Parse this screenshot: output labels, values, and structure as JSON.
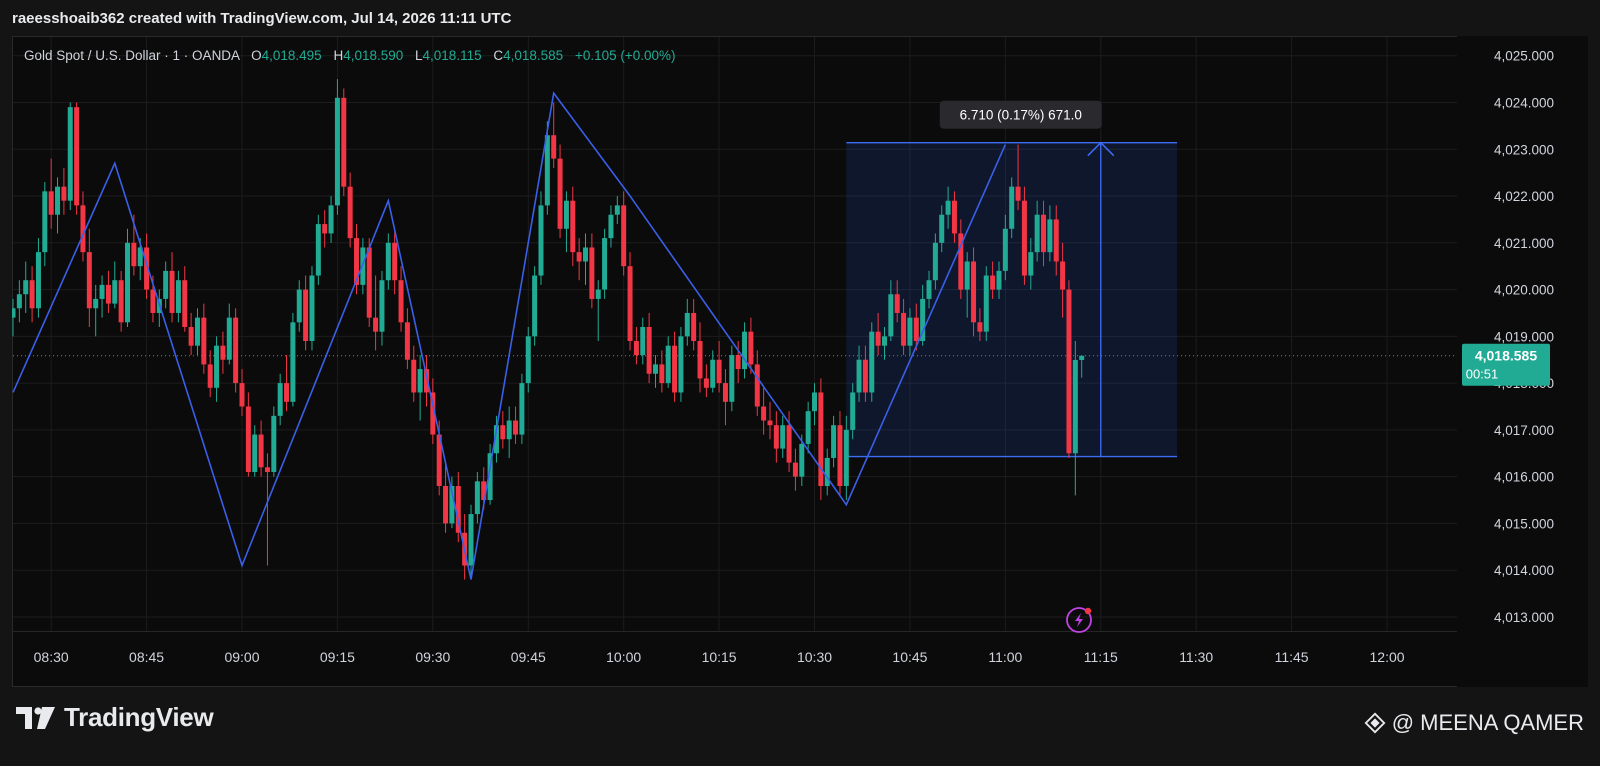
{
  "header": {
    "attribution": "raeesshoaib362 created with TradingView.com, Jul 14, 2026 11:11 UTC"
  },
  "legend": {
    "symbol": "Gold Spot / U.S. Dollar · 1 · OANDA",
    "open_label": "O",
    "open": "4,018.495",
    "high_label": "H",
    "high": "4,018.590",
    "low_label": "L",
    "low": "4,018.115",
    "close_label": "C",
    "close": "4,018.585",
    "change": "+0.105 (+0.00%)"
  },
  "price_tag": {
    "price": "4,018.585",
    "countdown": "00:51"
  },
  "measure": {
    "label": "6.710 (0.17%) 671.0",
    "from_time": "10:35",
    "to_time": "11:27",
    "low": 4016.43,
    "high": 4023.14,
    "arrow_time": "11:15"
  },
  "chart_data": {
    "type": "candlestick",
    "symbol": "Gold Spot / U.S. Dollar",
    "interval": "1",
    "exchange": "OANDA",
    "y_ticks": [
      "4,025.000",
      "4,024.000",
      "4,023.000",
      "4,022.000",
      "4,021.000",
      "4,020.000",
      "4,019.000",
      "4,018.000",
      "4,017.000",
      "4,016.000",
      "4,015.000",
      "4,014.000",
      "4,013.000"
    ],
    "x_ticks": [
      "08:30",
      "08:45",
      "09:00",
      "09:15",
      "09:30",
      "09:45",
      "10:00",
      "10:15",
      "10:30",
      "10:45",
      "11:00",
      "11:15",
      "11:30",
      "11:45",
      "12:00"
    ],
    "ylim": [
      4012.7,
      4025.4
    ],
    "xlim": [
      "08:24",
      "12:11"
    ],
    "last_price": 4018.585,
    "zigzag": [
      {
        "t": "08:24",
        "p": 4017.8
      },
      {
        "t": "08:40",
        "p": 4022.7
      },
      {
        "t": "09:00",
        "p": 4014.1
      },
      {
        "t": "09:23",
        "p": 4021.9
      },
      {
        "t": "09:36",
        "p": 4013.8
      },
      {
        "t": "09:49",
        "p": 4024.2
      },
      {
        "t": "10:01",
        "p": 4022.0
      },
      {
        "t": "10:35",
        "p": 4015.4
      },
      {
        "t": "11:00",
        "p": 4023.1
      }
    ],
    "candles": [
      [
        "08:24",
        4019.4,
        4019.8,
        4019.0,
        4019.6
      ],
      [
        "08:25",
        4019.6,
        4020.2,
        4019.3,
        4019.9
      ],
      [
        "08:26",
        4019.9,
        4020.6,
        4019.5,
        4020.2
      ],
      [
        "08:27",
        4020.2,
        4020.5,
        4019.3,
        4019.6
      ],
      [
        "08:28",
        4019.6,
        4021.1,
        4019.4,
        4020.8
      ],
      [
        "08:29",
        4020.8,
        4022.3,
        4020.5,
        4022.1
      ],
      [
        "08:30",
        4022.1,
        4022.8,
        4021.3,
        4021.6
      ],
      [
        "08:31",
        4021.6,
        4022.4,
        4021.2,
        4022.2
      ],
      [
        "08:32",
        4022.2,
        4022.6,
        4021.6,
        4021.9
      ],
      [
        "08:33",
        4021.9,
        4024.0,
        4021.7,
        4023.9
      ],
      [
        "08:34",
        4023.9,
        4024.0,
        4021.6,
        4021.8
      ],
      [
        "08:35",
        4021.8,
        4022.1,
        4020.6,
        4020.8
      ],
      [
        "08:36",
        4020.8,
        4021.3,
        4019.2,
        4019.6
      ],
      [
        "08:37",
        4019.6,
        4020.1,
        4019.0,
        4019.8
      ],
      [
        "08:38",
        4019.8,
        4020.3,
        4019.4,
        4020.1
      ],
      [
        "08:39",
        4020.1,
        4020.4,
        4019.5,
        4019.7
      ],
      [
        "08:40",
        4019.7,
        4020.6,
        4019.6,
        4020.2
      ],
      [
        "08:41",
        4020.2,
        4020.4,
        4019.1,
        4019.3
      ],
      [
        "08:42",
        4019.3,
        4021.3,
        4019.2,
        4021.0
      ],
      [
        "08:43",
        4021.0,
        4021.6,
        4020.3,
        4020.5
      ],
      [
        "08:44",
        4020.5,
        4021.1,
        4020.2,
        4020.9
      ],
      [
        "08:45",
        4020.9,
        4021.2,
        4019.8,
        4020.0
      ],
      [
        "08:46",
        4020.0,
        4020.3,
        4019.3,
        4019.5
      ],
      [
        "08:47",
        4019.5,
        4020.0,
        4019.2,
        4019.8
      ],
      [
        "08:48",
        4019.8,
        4020.6,
        4019.6,
        4020.4
      ],
      [
        "08:49",
        4020.4,
        4020.8,
        4019.3,
        4019.5
      ],
      [
        "08:50",
        4019.5,
        4020.4,
        4019.3,
        4020.2
      ],
      [
        "08:51",
        4020.2,
        4020.5,
        4019.1,
        4019.2
      ],
      [
        "08:52",
        4019.2,
        4019.5,
        4018.6,
        4018.8
      ],
      [
        "08:53",
        4018.8,
        4019.6,
        4018.6,
        4019.4
      ],
      [
        "08:54",
        4019.4,
        4019.7,
        4018.2,
        4018.4
      ],
      [
        "08:55",
        4018.4,
        4018.7,
        4017.7,
        4017.9
      ],
      [
        "08:56",
        4017.9,
        4019.0,
        4017.6,
        4018.8
      ],
      [
        "08:57",
        4018.8,
        4019.1,
        4018.2,
        4018.5
      ],
      [
        "08:58",
        4018.5,
        4019.7,
        4018.4,
        4019.4
      ],
      [
        "08:59",
        4019.4,
        4019.6,
        4017.8,
        4018.0
      ],
      [
        "09:00",
        4018.0,
        4018.3,
        4017.3,
        4017.5
      ],
      [
        "09:01",
        4017.5,
        4017.8,
        4016.0,
        4016.1
      ],
      [
        "09:02",
        4016.1,
        4017.1,
        4016.0,
        4016.9
      ],
      [
        "09:03",
        4016.9,
        4017.2,
        4016.0,
        4016.2
      ],
      [
        "09:04",
        4016.2,
        4016.5,
        4014.1,
        4016.1
      ],
      [
        "09:05",
        4016.1,
        4017.5,
        4016.0,
        4017.3
      ],
      [
        "09:06",
        4017.3,
        4018.2,
        4017.1,
        4018.0
      ],
      [
        "09:07",
        4018.0,
        4018.6,
        4017.4,
        4017.6
      ],
      [
        "09:08",
        4017.6,
        4019.5,
        4017.5,
        4019.3
      ],
      [
        "09:09",
        4019.3,
        4020.2,
        4019.1,
        4020.0
      ],
      [
        "09:10",
        4020.0,
        4020.3,
        4018.7,
        4018.9
      ],
      [
        "09:11",
        4018.9,
        4020.5,
        4018.7,
        4020.3
      ],
      [
        "09:12",
        4020.3,
        4021.6,
        4020.1,
        4021.4
      ],
      [
        "09:13",
        4021.4,
        4021.7,
        4020.9,
        4021.2
      ],
      [
        "09:14",
        4021.2,
        4022.0,
        4021.0,
        4021.8
      ],
      [
        "09:15",
        4021.8,
        4024.5,
        4021.6,
        4024.1
      ],
      [
        "09:16",
        4024.1,
        4024.3,
        4022.0,
        4022.2
      ],
      [
        "09:17",
        4022.2,
        4022.5,
        4020.9,
        4021.1
      ],
      [
        "09:18",
        4021.1,
        4021.4,
        4019.9,
        4020.1
      ],
      [
        "09:19",
        4020.1,
        4021.1,
        4019.9,
        4020.9
      ],
      [
        "09:20",
        4020.9,
        4021.1,
        4019.2,
        4019.4
      ],
      [
        "09:21",
        4019.4,
        4020.3,
        4018.7,
        4019.1
      ],
      [
        "09:22",
        4019.1,
        4020.4,
        4018.8,
        4020.2
      ],
      [
        "09:23",
        4020.2,
        4021.2,
        4020.0,
        4021.0
      ],
      [
        "09:24",
        4021.0,
        4021.3,
        4019.9,
        4020.2
      ],
      [
        "09:25",
        4020.2,
        4020.5,
        4019.1,
        4019.3
      ],
      [
        "09:26",
        4019.3,
        4019.6,
        4018.3,
        4018.5
      ],
      [
        "09:27",
        4018.5,
        4018.8,
        4017.6,
        4017.8
      ],
      [
        "09:28",
        4017.8,
        4018.6,
        4017.2,
        4018.3
      ],
      [
        "09:29",
        4018.3,
        4018.6,
        4017.5,
        4017.8
      ],
      [
        "09:30",
        4017.8,
        4018.1,
        4016.7,
        4016.9
      ],
      [
        "09:31",
        4016.9,
        4017.2,
        4015.6,
        4015.8
      ],
      [
        "09:32",
        4015.8,
        4016.3,
        4014.8,
        4015.0
      ],
      [
        "09:33",
        4015.0,
        4016.0,
        4014.9,
        4015.8
      ],
      [
        "09:34",
        4015.8,
        4016.1,
        4014.6,
        4014.8
      ],
      [
        "09:35",
        4014.8,
        4015.2,
        4013.8,
        4014.1
      ],
      [
        "09:36",
        4014.1,
        4015.4,
        4013.9,
        4015.2
      ],
      [
        "09:37",
        4015.2,
        4016.1,
        4015.0,
        4015.9
      ],
      [
        "09:38",
        4015.9,
        4016.2,
        4015.3,
        4015.5
      ],
      [
        "09:39",
        4015.5,
        4016.7,
        4015.4,
        4016.5
      ],
      [
        "09:40",
        4016.5,
        4017.3,
        4016.3,
        4017.1
      ],
      [
        "09:41",
        4017.1,
        4017.4,
        4016.6,
        4016.8
      ],
      [
        "09:42",
        4016.8,
        4017.5,
        4016.4,
        4017.2
      ],
      [
        "09:43",
        4017.2,
        4017.5,
        4016.7,
        4016.9
      ],
      [
        "09:44",
        4016.9,
        4018.2,
        4016.7,
        4018.0
      ],
      [
        "09:45",
        4018.0,
        4019.2,
        4017.8,
        4019.0
      ],
      [
        "09:46",
        4019.0,
        4020.5,
        4018.8,
        4020.3
      ],
      [
        "09:47",
        4020.3,
        4022.1,
        4020.1,
        4021.8
      ],
      [
        "09:48",
        4021.8,
        4023.6,
        4021.6,
        4023.3
      ],
      [
        "09:49",
        4023.3,
        4024.0,
        4022.6,
        4022.8
      ],
      [
        "09:50",
        4022.8,
        4023.1,
        4021.1,
        4021.3
      ],
      [
        "09:51",
        4021.3,
        4022.1,
        4020.8,
        4021.9
      ],
      [
        "09:52",
        4021.9,
        4022.2,
        4020.5,
        4020.8
      ],
      [
        "09:53",
        4020.8,
        4021.1,
        4020.2,
        4020.6
      ],
      [
        "09:54",
        4020.6,
        4021.2,
        4020.1,
        4020.9
      ],
      [
        "09:55",
        4020.9,
        4021.2,
        4019.6,
        4019.8
      ],
      [
        "09:56",
        4019.8,
        4020.2,
        4018.9,
        4020.0
      ],
      [
        "09:57",
        4020.0,
        4021.3,
        4019.8,
        4021.1
      ],
      [
        "09:58",
        4021.1,
        4021.8,
        4020.9,
        4021.6
      ],
      [
        "09:59",
        4021.6,
        4022.0,
        4021.4,
        4021.8
      ],
      [
        "10:00",
        4021.8,
        4022.1,
        4020.3,
        4020.5
      ],
      [
        "10:01",
        4020.5,
        4020.8,
        4018.7,
        4018.9
      ],
      [
        "10:02",
        4018.9,
        4019.2,
        4018.4,
        4018.6
      ],
      [
        "10:03",
        4018.6,
        4019.4,
        4018.4,
        4019.2
      ],
      [
        "10:04",
        4019.2,
        4019.5,
        4018.0,
        4018.2
      ],
      [
        "10:05",
        4018.2,
        4018.6,
        4017.9,
        4018.4
      ],
      [
        "10:06",
        4018.4,
        4018.7,
        4017.8,
        4018.0
      ],
      [
        "10:07",
        4018.0,
        4019.0,
        4017.9,
        4018.8
      ],
      [
        "10:08",
        4018.8,
        4019.1,
        4017.6,
        4017.8
      ],
      [
        "10:09",
        4017.8,
        4019.2,
        4017.6,
        4019.0
      ],
      [
        "10:10",
        4019.0,
        4019.8,
        4018.8,
        4019.5
      ],
      [
        "10:11",
        4019.5,
        4019.8,
        4018.7,
        4018.9
      ],
      [
        "10:12",
        4018.9,
        4019.3,
        4017.8,
        4018.1
      ],
      [
        "10:13",
        4018.1,
        4018.4,
        4017.7,
        4017.9
      ],
      [
        "10:14",
        4017.9,
        4018.7,
        4017.8,
        4018.5
      ],
      [
        "10:15",
        4018.5,
        4018.9,
        4017.8,
        4018.0
      ],
      [
        "10:16",
        4018.0,
        4018.3,
        4017.1,
        4017.6
      ],
      [
        "10:17",
        4017.6,
        4018.8,
        4017.4,
        4018.6
      ],
      [
        "10:18",
        4018.6,
        4018.9,
        4018.0,
        4018.3
      ],
      [
        "10:19",
        4018.3,
        4019.3,
        4018.1,
        4019.1
      ],
      [
        "10:20",
        4019.1,
        4019.4,
        4018.2,
        4018.4
      ],
      [
        "10:21",
        4018.4,
        4018.7,
        4017.3,
        4017.5
      ],
      [
        "10:22",
        4017.5,
        4017.9,
        4016.9,
        4017.2
      ],
      [
        "10:23",
        4017.2,
        4017.6,
        4016.8,
        4017.1
      ],
      [
        "10:24",
        4017.1,
        4017.4,
        4016.3,
        4016.6
      ],
      [
        "10:25",
        4016.6,
        4017.3,
        4016.4,
        4017.1
      ],
      [
        "10:26",
        4017.1,
        4017.4,
        4016.1,
        4016.3
      ],
      [
        "10:27",
        4016.3,
        4016.6,
        4015.7,
        4016.0
      ],
      [
        "10:28",
        4016.0,
        4016.9,
        4015.8,
        4016.7
      ],
      [
        "10:29",
        4016.7,
        4017.6,
        4016.5,
        4017.4
      ],
      [
        "10:30",
        4017.4,
        4018.0,
        4017.1,
        4017.8
      ],
      [
        "10:31",
        4017.8,
        4018.1,
        4015.5,
        4015.8
      ],
      [
        "10:32",
        4015.8,
        4016.6,
        4015.6,
        4016.4
      ],
      [
        "10:33",
        4016.4,
        4017.3,
        4016.2,
        4017.1
      ],
      [
        "10:34",
        4017.1,
        4017.4,
        4015.6,
        4015.8
      ],
      [
        "10:35",
        4015.8,
        4017.3,
        4015.5,
        4017.0
      ],
      [
        "10:36",
        4017.0,
        4018.0,
        4016.8,
        4017.8
      ],
      [
        "10:37",
        4017.8,
        4018.8,
        4017.6,
        4018.5
      ],
      [
        "10:38",
        4018.5,
        4018.8,
        4017.6,
        4017.8
      ],
      [
        "10:39",
        4017.8,
        4019.3,
        4017.6,
        4019.1
      ],
      [
        "10:40",
        4019.1,
        4019.5,
        4018.6,
        4018.8
      ],
      [
        "10:41",
        4018.8,
        4019.2,
        4018.5,
        4019.0
      ],
      [
        "10:42",
        4019.0,
        4020.2,
        4018.9,
        4019.9
      ],
      [
        "10:43",
        4019.9,
        4020.2,
        4019.3,
        4019.5
      ],
      [
        "10:44",
        4019.5,
        4019.8,
        4018.6,
        4018.8
      ],
      [
        "10:45",
        4018.8,
        4019.6,
        4018.6,
        4019.4
      ],
      [
        "10:46",
        4019.4,
        4019.7,
        4018.7,
        4018.9
      ],
      [
        "10:47",
        4018.9,
        4020.1,
        4018.8,
        4019.8
      ],
      [
        "10:48",
        4019.8,
        4020.4,
        4019.6,
        4020.2
      ],
      [
        "10:49",
        4020.2,
        4021.2,
        4020.0,
        4021.0
      ],
      [
        "10:50",
        4021.0,
        4021.8,
        4020.8,
        4021.6
      ],
      [
        "10:51",
        4021.6,
        4022.2,
        4021.3,
        4021.9
      ],
      [
        "10:52",
        4021.9,
        4022.1,
        4021.0,
        4021.2
      ],
      [
        "10:53",
        4021.2,
        4021.5,
        4019.8,
        4020.0
      ],
      [
        "10:54",
        4020.0,
        4020.8,
        4019.4,
        4020.6
      ],
      [
        "10:55",
        4020.6,
        4020.9,
        4019.0,
        4019.3
      ],
      [
        "10:56",
        4019.3,
        4019.6,
        4018.9,
        4019.1
      ],
      [
        "10:57",
        4019.1,
        4020.5,
        4018.9,
        4020.3
      ],
      [
        "10:58",
        4020.3,
        4020.6,
        4019.8,
        4020.0
      ],
      [
        "10:59",
        4020.0,
        4020.6,
        4019.8,
        4020.4
      ],
      [
        "11:00",
        4020.4,
        4021.6,
        4020.2,
        4021.3
      ],
      [
        "11:01",
        4021.3,
        4022.4,
        4021.1,
        4022.2
      ],
      [
        "11:02",
        4022.2,
        4023.1,
        4021.7,
        4021.9
      ],
      [
        "11:03",
        4021.9,
        4022.2,
        4020.1,
        4020.3
      ],
      [
        "11:04",
        4020.3,
        4021.1,
        4020.0,
        4020.8
      ],
      [
        "11:05",
        4020.8,
        4021.9,
        4020.6,
        4021.6
      ],
      [
        "11:06",
        4021.6,
        4021.9,
        4020.5,
        4020.8
      ],
      [
        "11:07",
        4020.8,
        4021.8,
        4020.6,
        4021.5
      ],
      [
        "11:08",
        4021.5,
        4021.8,
        4020.3,
        4020.6
      ],
      [
        "11:09",
        4020.6,
        4021.0,
        4019.4,
        4020.0
      ],
      [
        "11:10",
        4020.0,
        4020.2,
        4016.4,
        4016.5
      ],
      [
        "11:11",
        4016.5,
        4018.9,
        4015.6,
        4018.495
      ],
      [
        "11:12",
        4018.495,
        4018.59,
        4018.115,
        4018.585
      ]
    ]
  }
}
